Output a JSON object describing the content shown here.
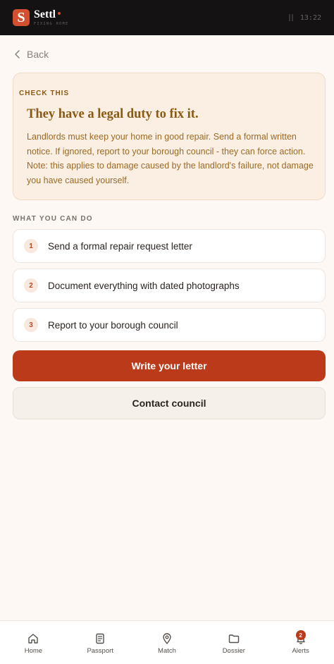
{
  "app": {
    "name": "Settl",
    "tagline": "FIXING HOME",
    "time": "13:22",
    "brand_color": "#d2502f"
  },
  "nav": {
    "back_label": "Back"
  },
  "callout": {
    "tag": "CHECK THIS",
    "title": "They have a legal duty to fix it.",
    "body": "Landlords must keep your home in good repair. Send a formal written notice. If ignored, report to your borough council - they can force action. Note: this applies to damage caused by the landlord's failure, not damage you have caused yourself."
  },
  "actions": {
    "section_label": "WHAT YOU CAN DO",
    "steps": [
      {
        "num": "1",
        "label": "Send a formal repair request letter"
      },
      {
        "num": "2",
        "label": "Document everything with dated photographs"
      },
      {
        "num": "3",
        "label": "Report to your borough council"
      }
    ],
    "primary_label": "Write your letter",
    "secondary_label": "Contact council"
  },
  "bottom_nav": {
    "items": [
      {
        "label": "Home",
        "icon": "home-icon"
      },
      {
        "label": "Passport",
        "icon": "document-icon"
      },
      {
        "label": "Match",
        "icon": "location-pin-icon"
      },
      {
        "label": "Dossier",
        "icon": "folder-icon"
      },
      {
        "label": "Alerts",
        "icon": "bell-icon",
        "badge": "2"
      }
    ]
  }
}
